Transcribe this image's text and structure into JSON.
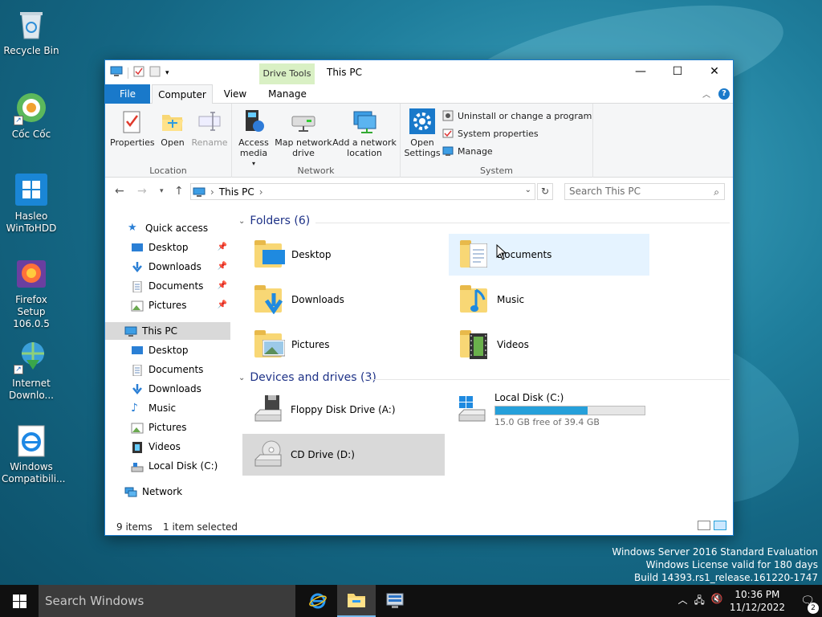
{
  "desktop": {
    "icons": [
      {
        "label": "Recycle Bin"
      },
      {
        "label": "Cốc Cốc"
      },
      {
        "label": "Hasleo WinToHDD"
      },
      {
        "label": "Firefox Setup 106.0.5"
      },
      {
        "label": "Internet Downlo..."
      },
      {
        "label": "Windows Compatibili..."
      }
    ]
  },
  "window": {
    "title": "This PC",
    "context_tab": "Drive Tools",
    "controls": {
      "minimize": "—",
      "maximize": "☐",
      "close": "✕"
    },
    "tabs": {
      "file": "File",
      "computer": "Computer",
      "view": "View",
      "manage": "Manage"
    },
    "ribbon": {
      "location": {
        "label": "Location",
        "properties": "Properties",
        "open": "Open",
        "rename": "Rename"
      },
      "network": {
        "label": "Network",
        "access_media": "Access media",
        "map_drive": "Map network drive",
        "add_location": "Add a network location"
      },
      "system": {
        "label": "System",
        "open_settings": "Open Settings",
        "uninstall": "Uninstall or change a program",
        "system_properties": "System properties",
        "manage": "Manage"
      }
    },
    "address": {
      "crumb": "This PC",
      "search_placeholder": "Search This PC"
    },
    "nav": {
      "quick_access": "Quick access",
      "quick_items": [
        "Desktop",
        "Downloads",
        "Documents",
        "Pictures"
      ],
      "this_pc": "This PC",
      "pc_items": [
        "Desktop",
        "Documents",
        "Downloads",
        "Music",
        "Pictures",
        "Videos",
        "Local Disk (C:)"
      ],
      "network": "Network"
    },
    "content": {
      "folders_header": "Folders (6)",
      "folders": [
        "Desktop",
        "Documents",
        "Downloads",
        "Music",
        "Pictures",
        "Videos"
      ],
      "devices_header": "Devices and drives (3)",
      "drives": {
        "floppy": "Floppy Disk Drive (A:)",
        "local": "Local Disk (C:)",
        "local_free": "15.0 GB free of 39.4 GB",
        "local_used_fraction": 0.62,
        "cd": "CD Drive (D:)"
      }
    },
    "status": {
      "items": "9 items",
      "selected": "1 item selected"
    }
  },
  "watermark": {
    "line1": "Windows Server 2016 Standard Evaluation",
    "line2": "Windows License valid for 180 days",
    "line3": "Build 14393.rs1_release.161220-1747"
  },
  "taskbar": {
    "search": "Search Windows",
    "time": "10:36 PM",
    "date": "11/12/2022",
    "notification_count": "2"
  },
  "colors": {
    "accent": "#1979ca",
    "drive_fill": "#26a0da",
    "context_tab": "#d9f0c4"
  }
}
